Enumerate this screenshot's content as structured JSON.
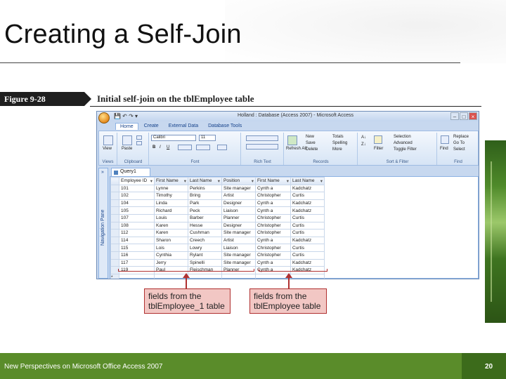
{
  "slide": {
    "title": "Creating a Self-Join",
    "footer_text": "New Perspectives on Microsoft Office Access 2007",
    "page_number": "20"
  },
  "figure": {
    "label": "Figure 9-28",
    "caption": "Initial self-join on the tblEmployee table"
  },
  "window": {
    "title": "Holland : Database (Access 2007) - Microsoft Access",
    "tabs": [
      "Home",
      "Create",
      "External Data",
      "Database Tools"
    ],
    "active_tab": "Home",
    "ribbon_groups": [
      "Views",
      "Clipboard",
      "Font",
      "Rich Text",
      "Records",
      "Sort & Filter",
      "Find"
    ],
    "ribbon_buttons": {
      "view": "View",
      "paste": "Paste",
      "font_name": "Calibri",
      "font_size": "11",
      "refresh": "Refresh All",
      "new": "New",
      "save": "Save",
      "delete": "Delete",
      "totals": "Totals",
      "spelling": "Spelling",
      "more": "More",
      "filter": "Filter",
      "selection": "Selection",
      "advanced": "Advanced",
      "toggle_filter": "Toggle Filter",
      "find": "Find",
      "replace": "Replace",
      "goto": "Go To",
      "select": "Select"
    },
    "nav_pane_label": "Navigation Pane",
    "doc_tab": "Query1",
    "columns": [
      "Employee ID",
      "First Name",
      "Last Name",
      "Position",
      "First Name",
      "Last Name"
    ],
    "rows": [
      [
        "101",
        "Lynne",
        "Perkins",
        "Site manager",
        "Cynth a",
        "Kadchatz"
      ],
      [
        "102",
        "Timothy",
        "Bring",
        "Artist",
        "Christopher",
        "Curtis"
      ],
      [
        "104",
        "Linda",
        "Park",
        "Designer",
        "Cynth a",
        "Kadchatz"
      ],
      [
        "105",
        "Richard",
        "Peck",
        "Liaison",
        "Cynth a",
        "Kadchatz"
      ],
      [
        "107",
        "Louis",
        "Barber",
        "Planner",
        "Christopher",
        "Curtis"
      ],
      [
        "108",
        "Karen",
        "Hesse",
        "Designer",
        "Christopher",
        "Curtis"
      ],
      [
        "112",
        "Karen",
        "Cushman",
        "Site manager",
        "Christopher",
        "Curtis"
      ],
      [
        "114",
        "Sharon",
        "Creech",
        "Artist",
        "Cynth a",
        "Kadchatz"
      ],
      [
        "115",
        "Lois",
        "Lowry",
        "Liaison",
        "Christopher",
        "Curtis"
      ],
      [
        "116",
        "Cynthia",
        "Rylant",
        "Site manager",
        "Christopher",
        "Curtis"
      ],
      [
        "117",
        "Jerry",
        "Spinelli",
        "Site manager",
        "Cynth a",
        "Kadchatz"
      ],
      [
        "119",
        "Paul",
        "Fleischman",
        "Planner",
        "Cynth a",
        "Kadchatz"
      ]
    ],
    "new_row_marker": "*"
  },
  "callouts": {
    "left": "fields from the tblEmployee_1 table",
    "right": "fields from the tblEmployee table"
  },
  "colors": {
    "footer_green": "#5a8c2a",
    "callout_fill": "#f2c7c4",
    "callout_border": "#b03030"
  }
}
